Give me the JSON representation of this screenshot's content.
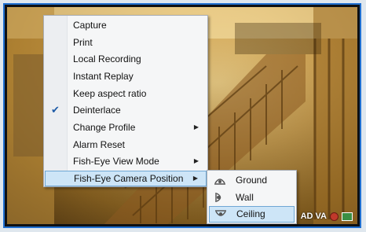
{
  "context_menu": {
    "items": [
      {
        "label": "Capture"
      },
      {
        "label": "Print"
      },
      {
        "label": "Local Recording"
      },
      {
        "label": "Instant Replay"
      },
      {
        "label": "Keep aspect ratio"
      },
      {
        "label": "Deinterlace",
        "checked": true
      },
      {
        "label": "Change Profile",
        "submenu": true
      },
      {
        "label": "Alarm Reset"
      },
      {
        "label": "Fish-Eye View Mode",
        "submenu": true
      },
      {
        "label": "Fish-Eye Camera Position",
        "submenu": true,
        "highlighted": true
      }
    ]
  },
  "submenu": {
    "items": [
      {
        "label": "Ground",
        "icon": "ground-mount-icon"
      },
      {
        "label": "Wall",
        "icon": "wall-mount-icon"
      },
      {
        "label": "Ceiling",
        "icon": "ceiling-mount-icon",
        "highlighted": true
      }
    ]
  },
  "status": {
    "label": "AD VA"
  },
  "colors": {
    "highlight": "#cde5f7",
    "highlight_border": "#6fa7d4",
    "frame": "#1f6fd0"
  }
}
